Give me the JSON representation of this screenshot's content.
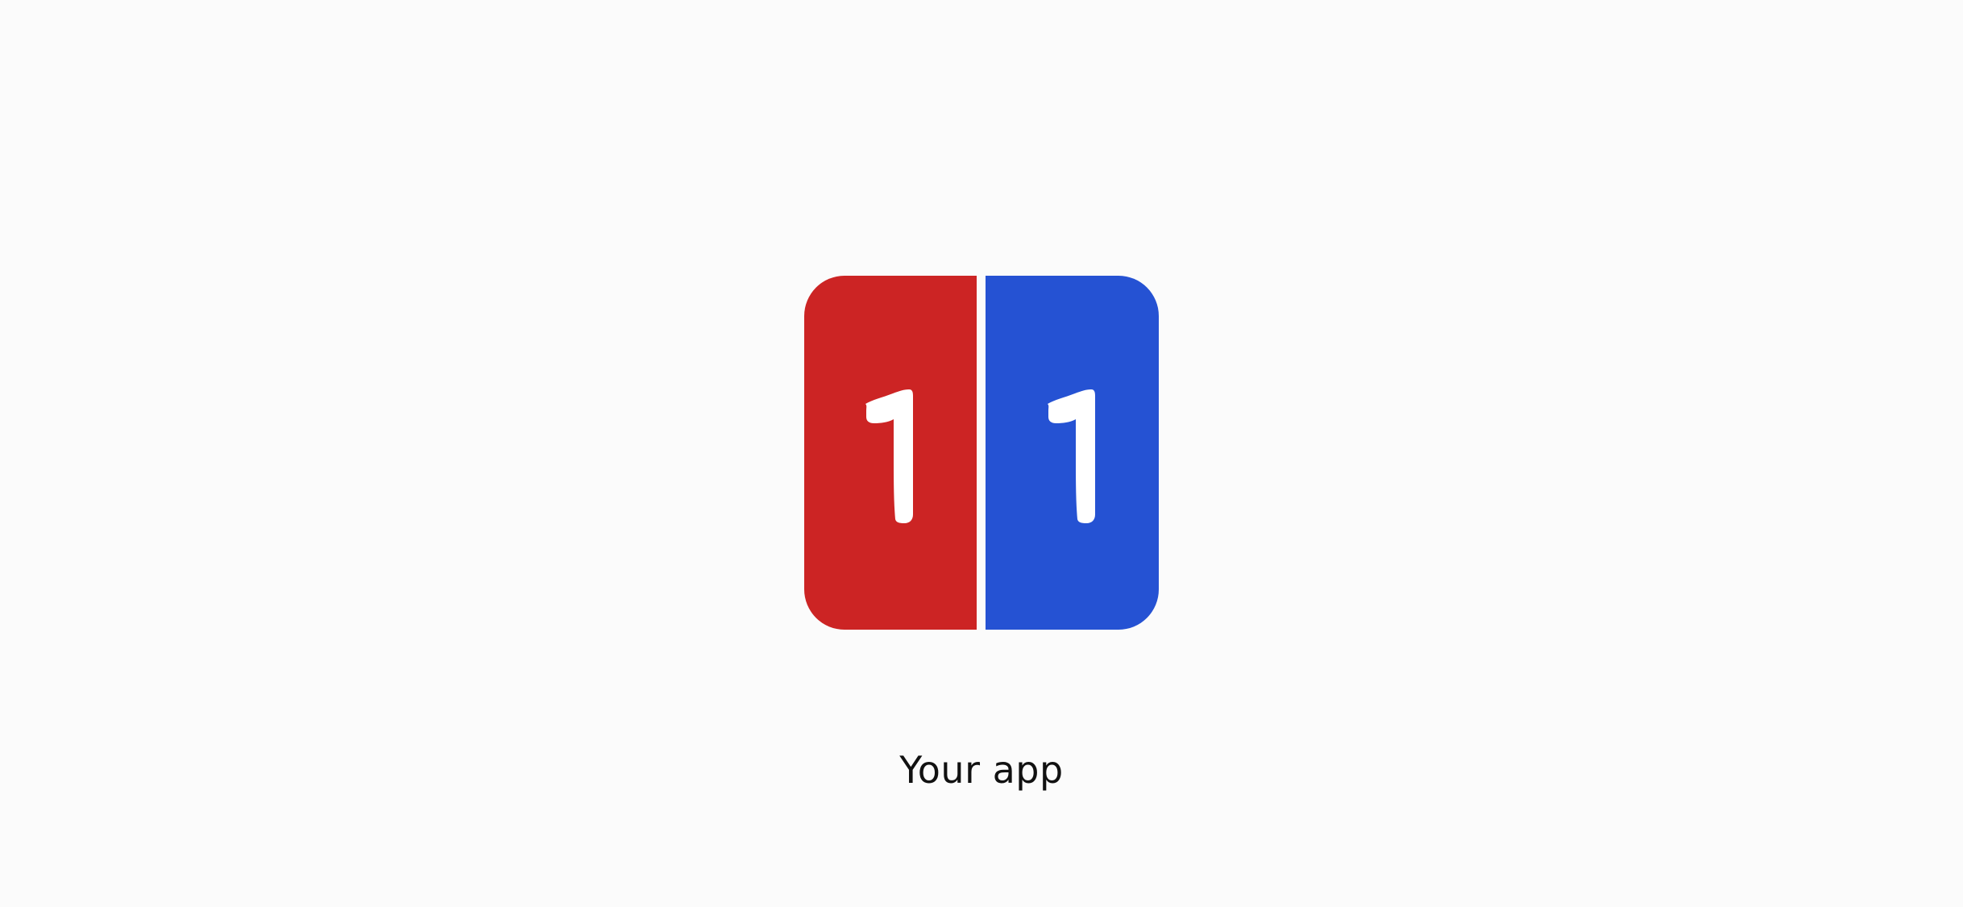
{
  "icon": {
    "left_panel": {
      "digit": "1",
      "color": "#cc2424"
    },
    "right_panel": {
      "digit": "1",
      "color": "#2552d3"
    },
    "digit_color": "#ffffff"
  },
  "app_label": "Your app"
}
